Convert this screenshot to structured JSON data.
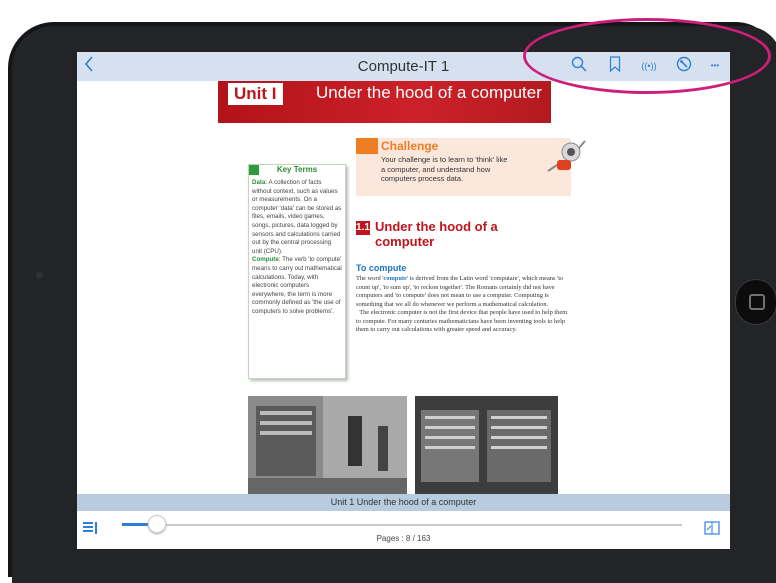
{
  "topbar": {
    "title": "Compute-IT 1",
    "back_icon": "chevron-left-icon",
    "icons": [
      "search-icon",
      "bookmark-icon",
      "broadcast-icon",
      "settings-icon",
      "more-icon"
    ],
    "more_glyph": "•••"
  },
  "page": {
    "unit_label": "Unit I",
    "banner_title": "Under the hood of a computer",
    "key_terms": {
      "title": "Key Terms",
      "term1": "Data",
      "def1": ": A collection of facts without context, such as values or measurements. On a computer 'data' can be stored as files, emails, video games, songs, pictures, data logged by sensors and calculations carried out by the central processing unit (CPU).",
      "term2": "Compute",
      "def2": ": The verb 'to compute' means to carry out mathematical calculations. Today, with electronic computers everywhere, the term is more commonly defined as 'the use of computers to solve problems'."
    },
    "challenge": {
      "title": "Challenge",
      "text": "Your challenge is to learn to 'think' like a computer, and understand how computers process data."
    },
    "section_number": "1.1",
    "section_title": "Under the hood of a computer",
    "subheading": "To compute",
    "paragraph1_a": "The word '",
    "paragraph1_term": "compute",
    "paragraph1_b": "' is derived from the Latin word 'computare', which means 'to count up', 'to sum up', 'to reckon together'. The Romans certainly did not have computers and 'to compute' does not mean to use a computer. Computing is something that we all do whenever we perform a mathematical calculation.",
    "paragraph2": "The electronic computer is not the first device that people have used to help them to compute. For many centuries mathematicians have been inventing tools to help them to carry out calculations with greater speed and accuracy."
  },
  "caption": "Unit 1 Under the hood of a computer",
  "bottombar": {
    "pages_label": "Pages : 8 / 163",
    "current_page": 8,
    "total_pages": 163,
    "left_icon": "toc-icon",
    "right_icon": "page-view-icon"
  },
  "colors": {
    "accent": "#2f7fd8",
    "banner": "#cc2128",
    "highlight": "#cc1f7a",
    "challenge": "#ef7d23",
    "key_terms": "#2d8c3a"
  }
}
